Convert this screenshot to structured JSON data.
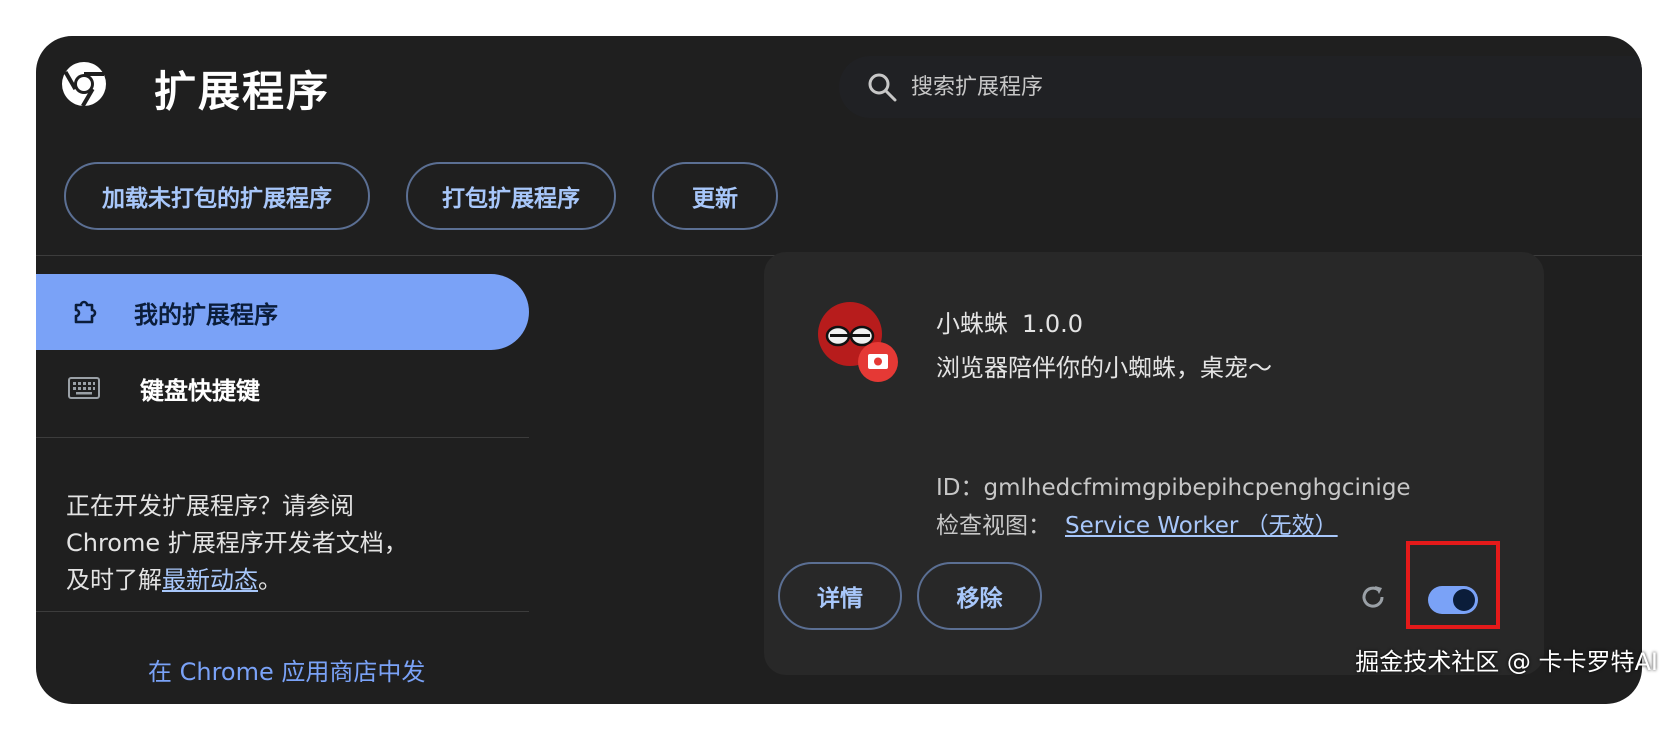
{
  "header": {
    "title": "扩展程序",
    "search_placeholder": "搜索扩展程序",
    "icons": {
      "logo": "chrome-logo-icon",
      "search": "search-icon"
    }
  },
  "toolbar": {
    "load_unpacked": "加载未打包的扩展程序",
    "pack": "打包扩展程序",
    "update": "更新"
  },
  "sidebar": {
    "items": [
      {
        "label": "我的扩展程序",
        "icon": "puzzle-icon",
        "active": true
      },
      {
        "label": "键盘快捷键",
        "icon": "keyboard-icon",
        "active": false
      }
    ],
    "dev_text_line1": "正在开发扩展程序？请参阅",
    "dev_text_line2": "Chrome 扩展程序开发者文档，",
    "dev_text_prefix": "及时了解",
    "dev_text_link": "最新动态",
    "dev_text_suffix": "。",
    "bottom_link": "在 Chrome 应用商店中发"
  },
  "extension": {
    "name": "小蛛蛛",
    "version": "1.0.0",
    "description": "浏览器陪伴你的小蜘蛛，桌宠～",
    "id_line": "ID：gmlhedcfmimgpibepihcpenghgcinige",
    "inspect_label": "检查视图：",
    "inspect_link": "Service Worker （无效）",
    "details_button": "详情",
    "remove_button": "移除",
    "enabled": true,
    "icons": {
      "ext": "spider-face-icon",
      "reload": "reload-icon"
    }
  },
  "colors": {
    "background": "#1f1f1f",
    "card": "#282828",
    "accent": "#7aa2f7",
    "link": "#a8c7fa",
    "highlight": "#e41a1a"
  },
  "watermark": "掘金技术社区 @ 卡卡罗特AI"
}
